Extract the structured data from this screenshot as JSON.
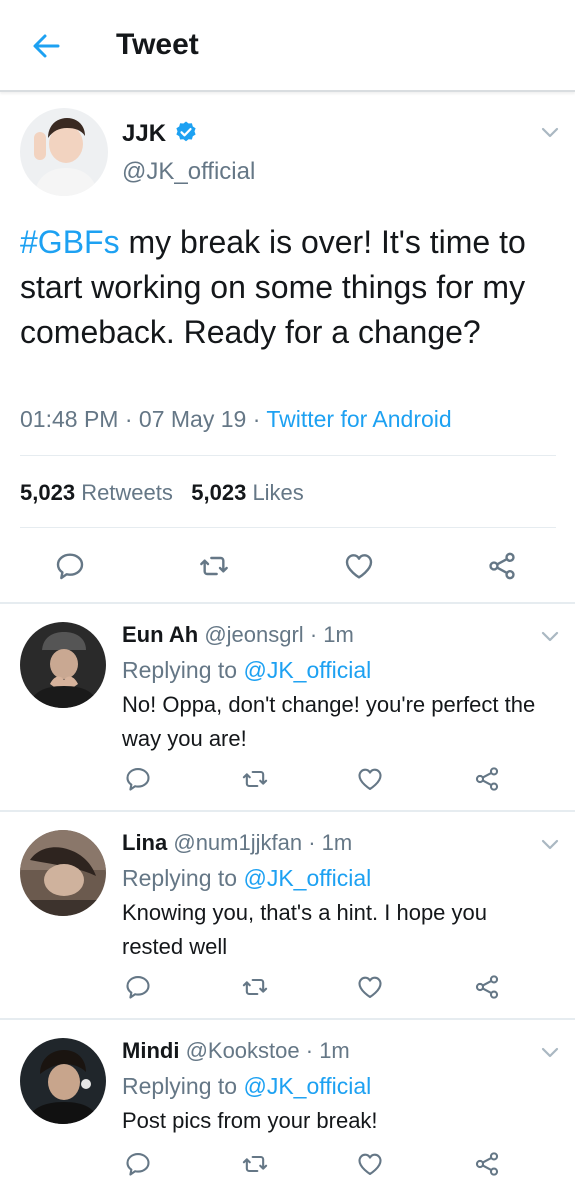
{
  "header": {
    "title": "Tweet",
    "back_icon": "arrow-left-icon",
    "accent": "#1da1f2"
  },
  "main_tweet": {
    "name": "JJK",
    "handle": "@JK_official",
    "hashtag": "#GBFs",
    "text": " my break is over! It's time to start working on some things for my comeback. Ready for a change?",
    "time": "01:48 PM",
    "date": "07 May 19",
    "source": "Twitter for Android",
    "retweets_count": "5,023",
    "retweets_label": "Retweets",
    "likes_count": "5,023",
    "likes_label": "Likes",
    "verified_icon": "verified-badge-icon"
  },
  "replies": [
    {
      "name": "Eun Ah",
      "handle": "@jeonsgrl",
      "age": "1m",
      "replying_prefix": "Replying to",
      "replying_to": "@JK_official",
      "text": "No! Oppa, don't change! you're perfect the way you are!"
    },
    {
      "name": "Lina",
      "handle": "@num1jjkfan",
      "age": "1m",
      "replying_prefix": "Replying to",
      "replying_to": "@JK_official",
      "text": "Knowing you, that's a hint. I hope you rested well"
    },
    {
      "name": "Mindi",
      "handle": "@Kookstoe",
      "age": "1m",
      "replying_prefix": "Replying to",
      "replying_to": "@JK_official",
      "text": "Post pics from your break!"
    }
  ]
}
